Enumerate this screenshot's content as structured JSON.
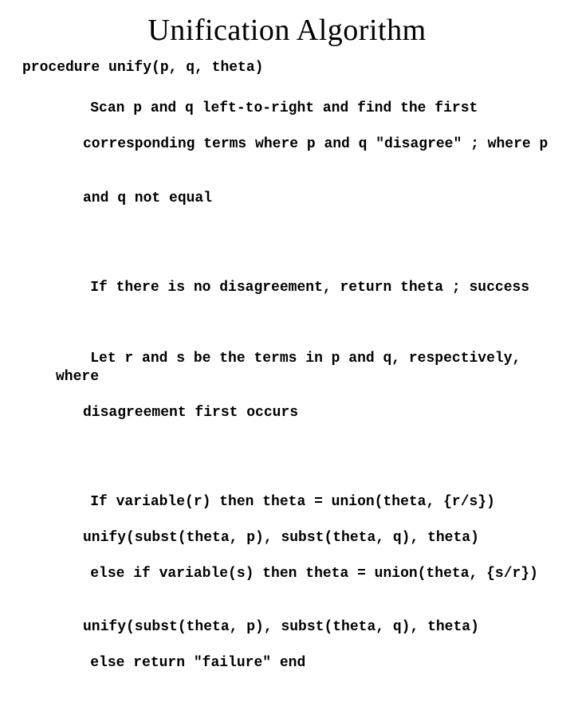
{
  "title": "Unification Algorithm",
  "procedure": "procedure unify(p, q, theta)",
  "para1_l1": "Scan p and q left-to-right and find the first",
  "para1_l2": "corresponding terms where p and q \"disagree\" ; where p",
  "para1_l3": "and q not equal",
  "para2": "If there is no disagreement, return theta ; success",
  "para3_l1": "Let r and s be the terms in p and q, respectively, where",
  "para3_l2": "disagreement first occurs",
  "para4_l1": "If variable(r) then theta = union(theta, {r/s})",
  "para4_l2": "unify(subst(theta, p), subst(theta, q), theta)",
  "para4_l3": "else if variable(s) then theta = union(theta, {s/r})",
  "para4_l4": "unify(subst(theta, p), subst(theta, q), theta)",
  "para4_l5": "else return \"failure\" end"
}
